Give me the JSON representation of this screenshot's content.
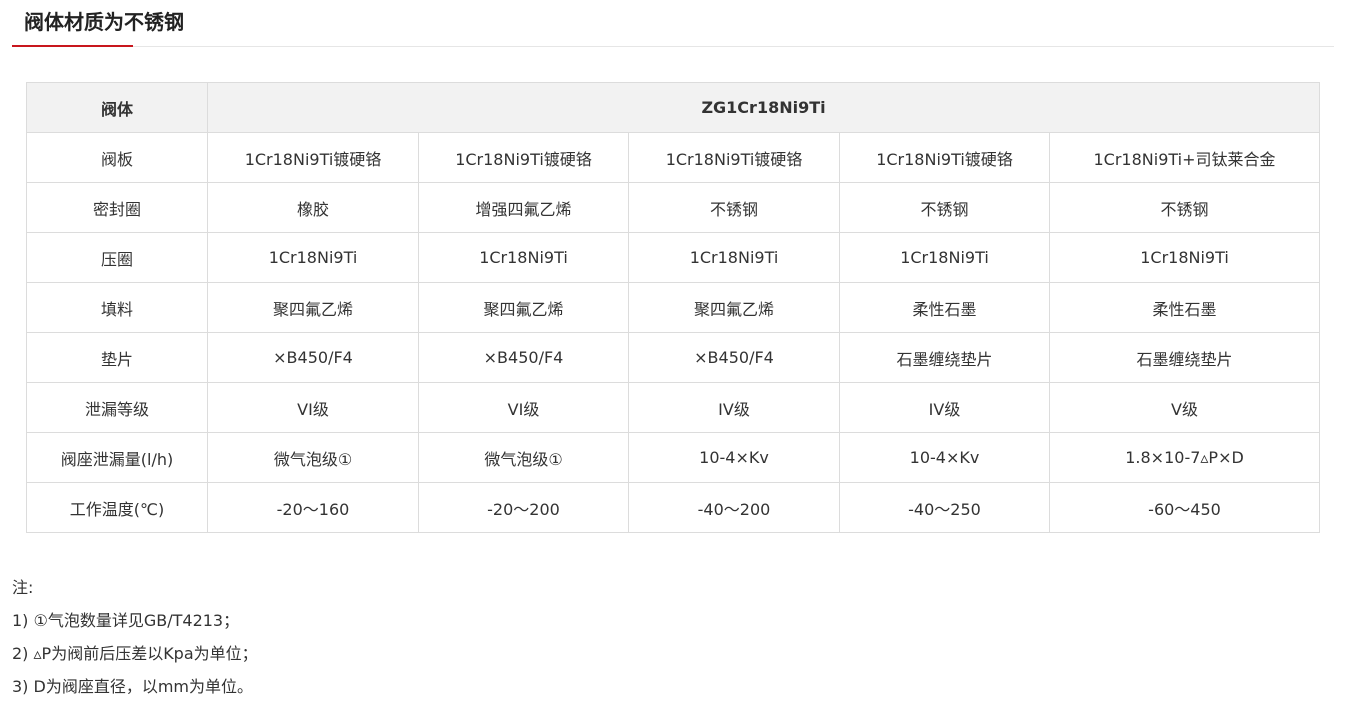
{
  "section": {
    "title": "阀体材质为不锈钢",
    "accent_color": "#c8161d"
  },
  "table": {
    "header": {
      "label": "阀体",
      "value": "ZG1Cr18Ni9Ti"
    },
    "rows": [
      {
        "label": "阀板",
        "cells": [
          "1Cr18Ni9Ti镀硬铬",
          "1Cr18Ni9Ti镀硬铬",
          "1Cr18Ni9Ti镀硬铬",
          "1Cr18Ni9Ti镀硬铬",
          "1Cr18Ni9Ti+司钛莱合金"
        ]
      },
      {
        "label": "密封圈",
        "cells": [
          "橡胶",
          "增强四氟乙烯",
          "不锈钢",
          "不锈钢",
          "不锈钢"
        ]
      },
      {
        "label": "压圈",
        "cells": [
          "1Cr18Ni9Ti",
          "1Cr18Ni9Ti",
          "1Cr18Ni9Ti",
          "1Cr18Ni9Ti",
          "1Cr18Ni9Ti"
        ]
      },
      {
        "label": "填料",
        "cells": [
          "聚四氟乙烯",
          "聚四氟乙烯",
          "聚四氟乙烯",
          "柔性石墨",
          "柔性石墨"
        ]
      },
      {
        "label": "垫片",
        "cells": [
          "×B450/F4",
          "×B450/F4",
          "×B450/F4",
          "石墨缠绕垫片",
          "石墨缠绕垫片"
        ]
      },
      {
        "label": "泄漏等级",
        "cells": [
          "VI级",
          "VI级",
          "IV级",
          "IV级",
          "Ⅴ级"
        ]
      },
      {
        "label": "阀座泄漏量(l/h)",
        "cells": [
          "微气泡级①",
          "微气泡级①",
          "10-4×Kv",
          "10-4×Kv",
          "1.8×10-7▵P×D"
        ]
      },
      {
        "label": "工作温度(℃)",
        "cells": [
          "-20～160",
          "-20～200",
          "-40～200",
          "-40～250",
          "-60～450"
        ]
      }
    ]
  },
  "notes": {
    "heading": "注:",
    "items": [
      "1) ①气泡数量详见GB/T4213；",
      "2) ▵P为阀前后压差以Kpa为单位；",
      "3) D为阀座直径，以mm为单位。"
    ]
  }
}
